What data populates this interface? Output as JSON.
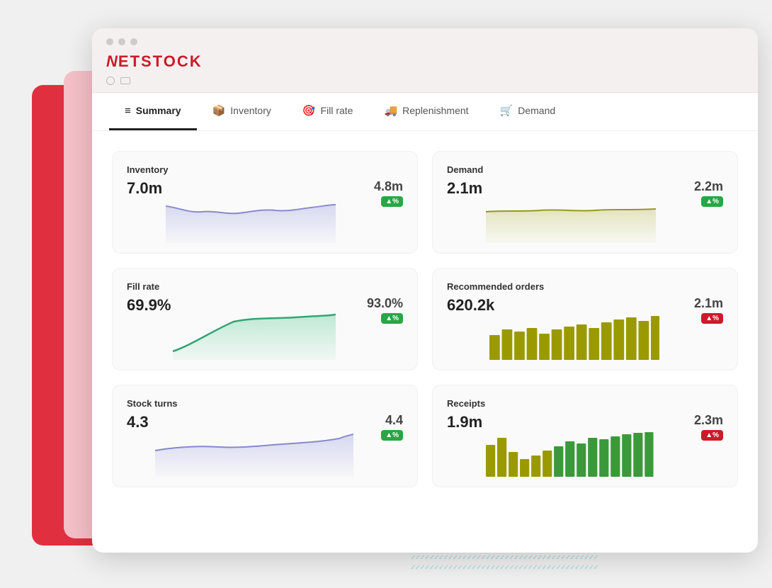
{
  "app": {
    "logo_n": "N",
    "logo_rest": "ETSTOCK"
  },
  "tabs": [
    {
      "id": "summary",
      "label": "Summary",
      "icon": "≡",
      "active": true
    },
    {
      "id": "inventory",
      "label": "Inventory",
      "icon": "📦",
      "active": false
    },
    {
      "id": "fillrate",
      "label": "Fill rate",
      "icon": "🎯",
      "active": false
    },
    {
      "id": "replenishment",
      "label": "Replenishment",
      "icon": "🚚",
      "active": false
    },
    {
      "id": "demand",
      "label": "Demand",
      "icon": "🛒",
      "active": false
    }
  ],
  "metrics": [
    {
      "id": "inventory",
      "label": "Inventory",
      "start_value": "7.0m",
      "end_value": "4.8m",
      "badge_text": "▲%",
      "badge_type": "green",
      "chart_type": "area_line",
      "chart_color": "#7b7ec8",
      "chart_fill": "rgba(180,182,230,0.35)"
    },
    {
      "id": "demand",
      "label": "Demand",
      "start_value": "2.1m",
      "end_value": "2.2m",
      "badge_text": "▲%",
      "badge_type": "green",
      "chart_type": "area_line",
      "chart_color": "#8a8a00",
      "chart_fill": "rgba(200,200,150,0.3)"
    },
    {
      "id": "fillrate",
      "label": "Fill rate",
      "start_value": "69.9%",
      "end_value": "93.0%",
      "badge_text": "▲%",
      "badge_type": "green",
      "chart_type": "area_line",
      "chart_color": "#2e9e6e",
      "chart_fill": "rgba(100,220,160,0.25)"
    },
    {
      "id": "recommended-orders",
      "label": "Recommended orders",
      "start_value": "620.2k",
      "end_value": "2.1m",
      "badge_text": "▲%",
      "badge_type": "red",
      "chart_type": "bar",
      "chart_color": "#8a8a00"
    },
    {
      "id": "stockturns",
      "label": "Stock turns",
      "start_value": "4.3",
      "end_value": "4.4",
      "badge_text": "▲%",
      "badge_type": "green",
      "chart_type": "area_line",
      "chart_color": "#7b7ec8",
      "chart_fill": "rgba(180,182,230,0.35)"
    },
    {
      "id": "receipts",
      "label": "Receipts",
      "start_value": "1.9m",
      "end_value": "2.3m",
      "badge_text": "▲%",
      "badge_type": "red",
      "chart_type": "bar_mixed",
      "chart_color": "#8a8a00",
      "chart_color2": "#3a9a3a"
    }
  ],
  "colors": {
    "accent_red": "#cc1a2a",
    "tab_active_border": "#222222",
    "purple_line": "#7b7ec8",
    "olive_line": "#8a8a00",
    "green_line": "#2e9e6e",
    "bar_olive": "#9a9a00",
    "bar_green": "#3a9a3a",
    "badge_green": "#28a745",
    "badge_red": "#cc1a2a"
  }
}
